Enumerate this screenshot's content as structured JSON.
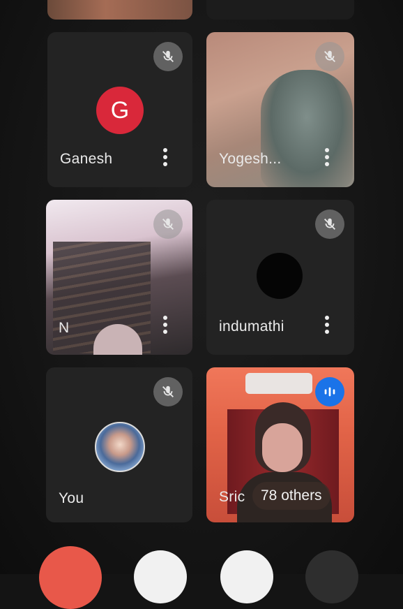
{
  "participants": [
    {
      "name": "Ganesh",
      "avatar_letter": "G",
      "avatar_color": "#d9283a",
      "muted": true
    },
    {
      "name": "Yogesh...",
      "muted": true,
      "video": true
    },
    {
      "name": "N",
      "muted": true,
      "video": true
    },
    {
      "name": "indumathi",
      "muted": true
    },
    {
      "name": "You",
      "muted": true
    },
    {
      "name": "Sric",
      "speaking": true,
      "video": true
    }
  ],
  "others_count_label": "78 others",
  "colors": {
    "background": "#141414",
    "tile": "#2a2a2a",
    "mute_badge": "#8f8f8f",
    "speaking_badge": "#1a73e8",
    "end_call": "#e8584a"
  },
  "icons": {
    "mute": "mic-off-icon",
    "speaking": "audio-wave-icon",
    "more": "more-vert-icon"
  }
}
